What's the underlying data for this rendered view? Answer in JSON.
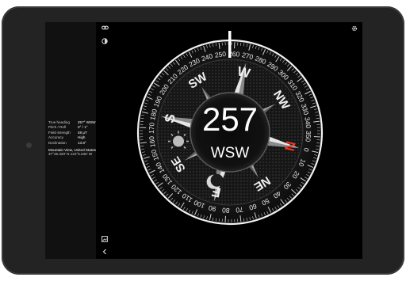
{
  "toolbar": {
    "link_icon": "link-icon",
    "theme_icon": "contrast-icon",
    "settings_icon": "gear-icon",
    "image_icon": "image-icon",
    "back_icon": "chevron-left-icon"
  },
  "info": {
    "rows": [
      {
        "label": "True heading",
        "value": "257° WSW"
      },
      {
        "label": "Pitch / Roll",
        "value": "0° / 1°"
      },
      {
        "label": "Field strength",
        "value": "48 μT"
      },
      {
        "label": "Accuracy",
        "value": "High"
      },
      {
        "label": "Declination",
        "value": "13.8°"
      }
    ],
    "location_name": "Mountain View, United States",
    "coordinates": "37°25.320' N 122°5.646' W"
  },
  "compass": {
    "heading_value": "257",
    "heading_direction": "WSW",
    "degree_labels": [
      "0",
      "10",
      "20",
      "30",
      "40",
      "50",
      "60",
      "70",
      "80",
      "90",
      "100",
      "110",
      "120",
      "130",
      "140",
      "150",
      "160",
      "170",
      "180",
      "190",
      "200",
      "210",
      "220",
      "230",
      "240",
      "250",
      "260",
      "270",
      "280",
      "290",
      "300",
      "310",
      "320",
      "330",
      "340",
      "350"
    ],
    "cardinals": [
      {
        "label": "N",
        "bearing": 0
      },
      {
        "label": "NE",
        "bearing": 45
      },
      {
        "label": "E",
        "bearing": 90
      },
      {
        "label": "SE",
        "bearing": 135
      },
      {
        "label": "S",
        "bearing": 180
      },
      {
        "label": "SW",
        "bearing": 225
      },
      {
        "label": "W",
        "bearing": 270
      },
      {
        "label": "NW",
        "bearing": 315
      }
    ],
    "north_color": "#e03a2a",
    "marker_color": "#ffffff"
  }
}
